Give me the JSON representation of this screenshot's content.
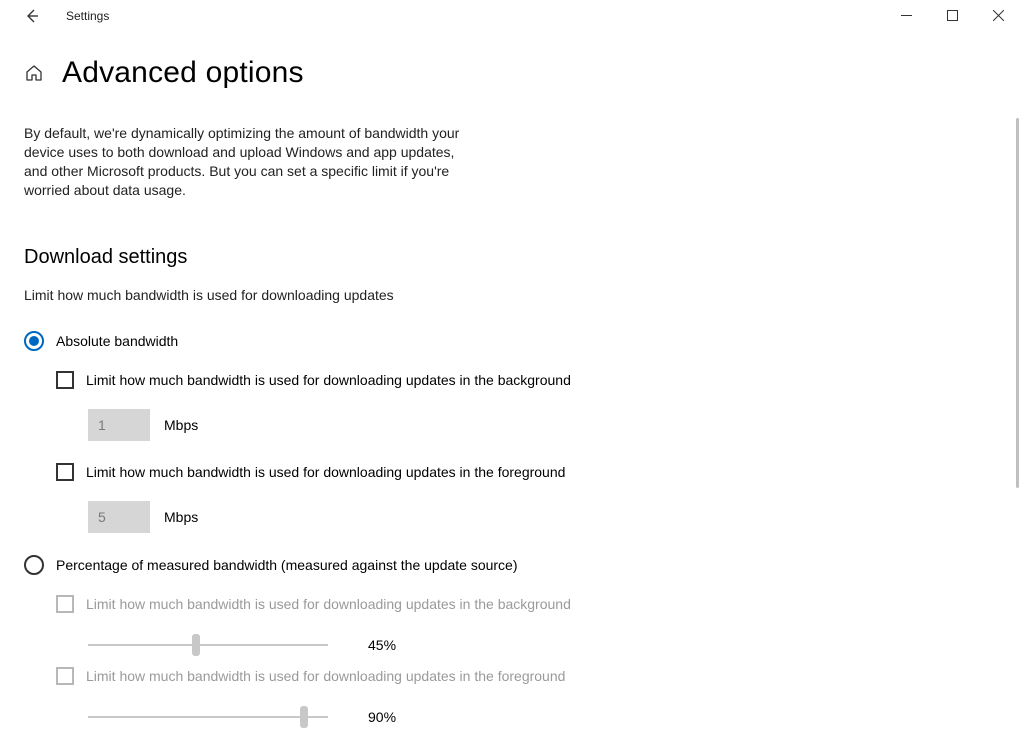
{
  "window": {
    "app_title": "Settings"
  },
  "page": {
    "title": "Advanced options",
    "intro": "By default, we're dynamically optimizing the amount of bandwidth your device uses to both download and upload Windows and app updates, and other Microsoft products. But you can set a specific limit if you're worried about data usage."
  },
  "download": {
    "heading": "Download settings",
    "subtext": "Limit how much bandwidth is used for downloading updates",
    "radio_absolute": {
      "label": "Absolute bandwidth",
      "selected": true
    },
    "bg_check": {
      "label": "Limit how much bandwidth is used for downloading updates in the background"
    },
    "bg_input": {
      "value": "1",
      "unit": "Mbps"
    },
    "fg_check": {
      "label": "Limit how much bandwidth is used for downloading updates in the foreground"
    },
    "fg_input": {
      "value": "5",
      "unit": "Mbps"
    },
    "radio_percent": {
      "label": "Percentage of measured bandwidth (measured against the update source)",
      "selected": false
    },
    "pct_bg_check": {
      "label": "Limit how much bandwidth is used for downloading updates in the background"
    },
    "pct_bg_slider": {
      "value": 45,
      "display": "45%"
    },
    "pct_fg_check": {
      "label": "Limit how much bandwidth is used for downloading updates in the foreground"
    },
    "pct_fg_slider": {
      "value": 90,
      "display": "90%"
    }
  }
}
